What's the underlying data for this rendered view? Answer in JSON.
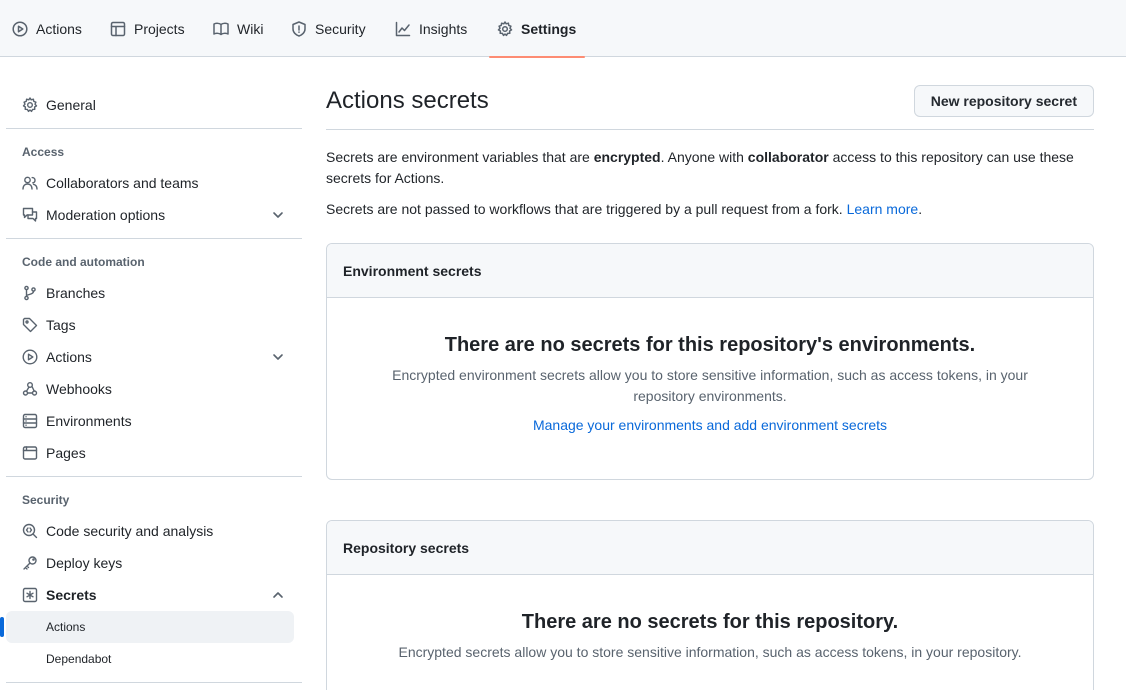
{
  "tabs": [
    {
      "label": "Actions",
      "icon": "play-icon"
    },
    {
      "label": "Projects",
      "icon": "table-icon"
    },
    {
      "label": "Wiki",
      "icon": "book-icon"
    },
    {
      "label": "Security",
      "icon": "shield-icon"
    },
    {
      "label": "Insights",
      "icon": "graph-icon"
    },
    {
      "label": "Settings",
      "icon": "gear-icon",
      "active": true
    }
  ],
  "sidebar": {
    "general": "General",
    "access": {
      "heading": "Access",
      "collaborators": "Collaborators and teams",
      "moderation": "Moderation options"
    },
    "code": {
      "heading": "Code and automation",
      "branches": "Branches",
      "tags": "Tags",
      "actions": "Actions",
      "webhooks": "Webhooks",
      "environments": "Environments",
      "pages": "Pages"
    },
    "security": {
      "heading": "Security",
      "code_security": "Code security and analysis",
      "deploy_keys": "Deploy keys",
      "secrets": "Secrets",
      "secrets_sub": [
        "Actions",
        "Dependabot"
      ],
      "active_sub": "Actions"
    }
  },
  "main": {
    "title": "Actions secrets",
    "new_button": "New repository secret",
    "intro": {
      "t1": "Secrets are environment variables that are ",
      "b1": "encrypted",
      "t2": ". Anyone with ",
      "b2": "collaborator",
      "t3": " access to this repository can use these secrets for Actions."
    },
    "note": {
      "text": "Secrets are not passed to workflows that are triggered by a pull request from a fork. ",
      "link": "Learn more",
      "end": "."
    },
    "env_box": {
      "header": "Environment secrets",
      "blank_title": "There are no secrets for this repository's environments.",
      "blank_text": "Encrypted environment secrets allow you to store sensitive information, such as access tokens, in your repository environments.",
      "link": "Manage your environments and add environment secrets"
    },
    "repo_box": {
      "header": "Repository secrets",
      "blank_title": "There are no secrets for this repository.",
      "blank_text": "Encrypted secrets allow you to store sensitive information, such as access tokens, in your repository."
    }
  },
  "colors": {
    "accent_underline": "#fd8c73",
    "link": "#0969da",
    "border": "#d0d7de",
    "muted": "#59636e"
  }
}
